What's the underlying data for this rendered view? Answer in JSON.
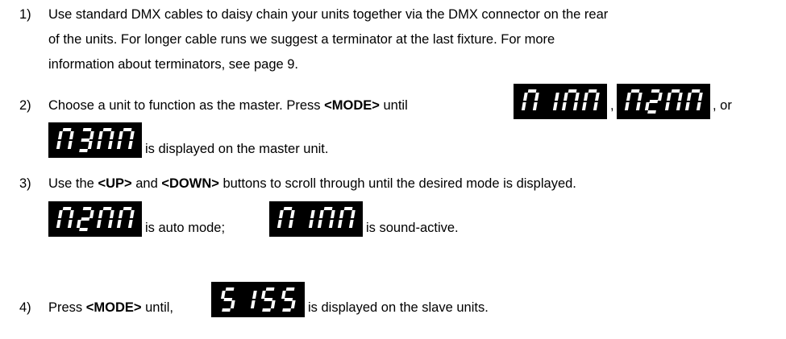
{
  "steps": [
    {
      "number": "1)",
      "lines": [
        "Use standard DMX cables to daisy chain your units together via the DMX connector on the rear",
        "of the units. For longer cable runs we suggest a terminator at the last fixture. For more",
        "information about terminators, see page 9."
      ]
    },
    {
      "number": "2)",
      "text_a": "Choose a unit to function as the master. Press ",
      "key": "<MODE>",
      "text_b": " until ",
      "sep_1": ",",
      "sep_2": ", or",
      "text_c": " is displayed on the master unit."
    },
    {
      "number": "3)",
      "text_a": "Use the ",
      "key_up": "<UP>",
      "text_b": " and ",
      "key_down": "<DOWN>",
      "text_c": " buttons to scroll through until the desired mode is displayed.",
      "text_d": " is auto mode; ",
      "text_e": " is sound-active."
    },
    {
      "number": "4)",
      "text_a": "Press ",
      "key": "<MODE>",
      "text_b": " until, ",
      "text_c": " is displayed on the slave units."
    }
  ],
  "displays": {
    "m1mm": "M 1MM",
    "m2mm": "M2MM",
    "m3mm": "M3MM",
    "s1s5": "S 1S S"
  }
}
